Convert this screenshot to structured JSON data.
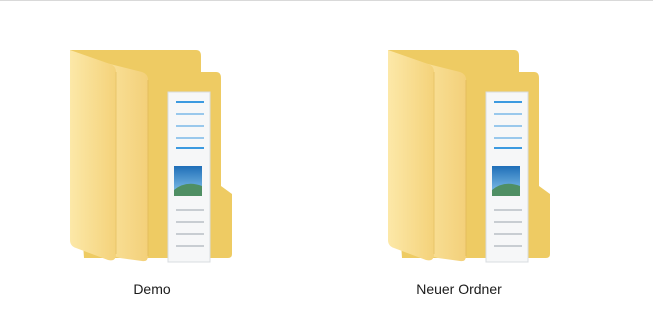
{
  "window": {
    "view": "large-icons"
  },
  "items": [
    {
      "label": "Demo",
      "icon": "folder-with-documents-icon"
    },
    {
      "label": "Neuer Ordner",
      "icon": "folder-with-documents-icon"
    }
  ],
  "colors": {
    "folder_back": "#EFC75E",
    "folder_front": "#FBE39A",
    "folder_mid": "#F6D57C",
    "paper": "#F4F6F8",
    "paper_lines_blue": "#3C9AE0",
    "photo_sky": "#3E8FC8"
  }
}
